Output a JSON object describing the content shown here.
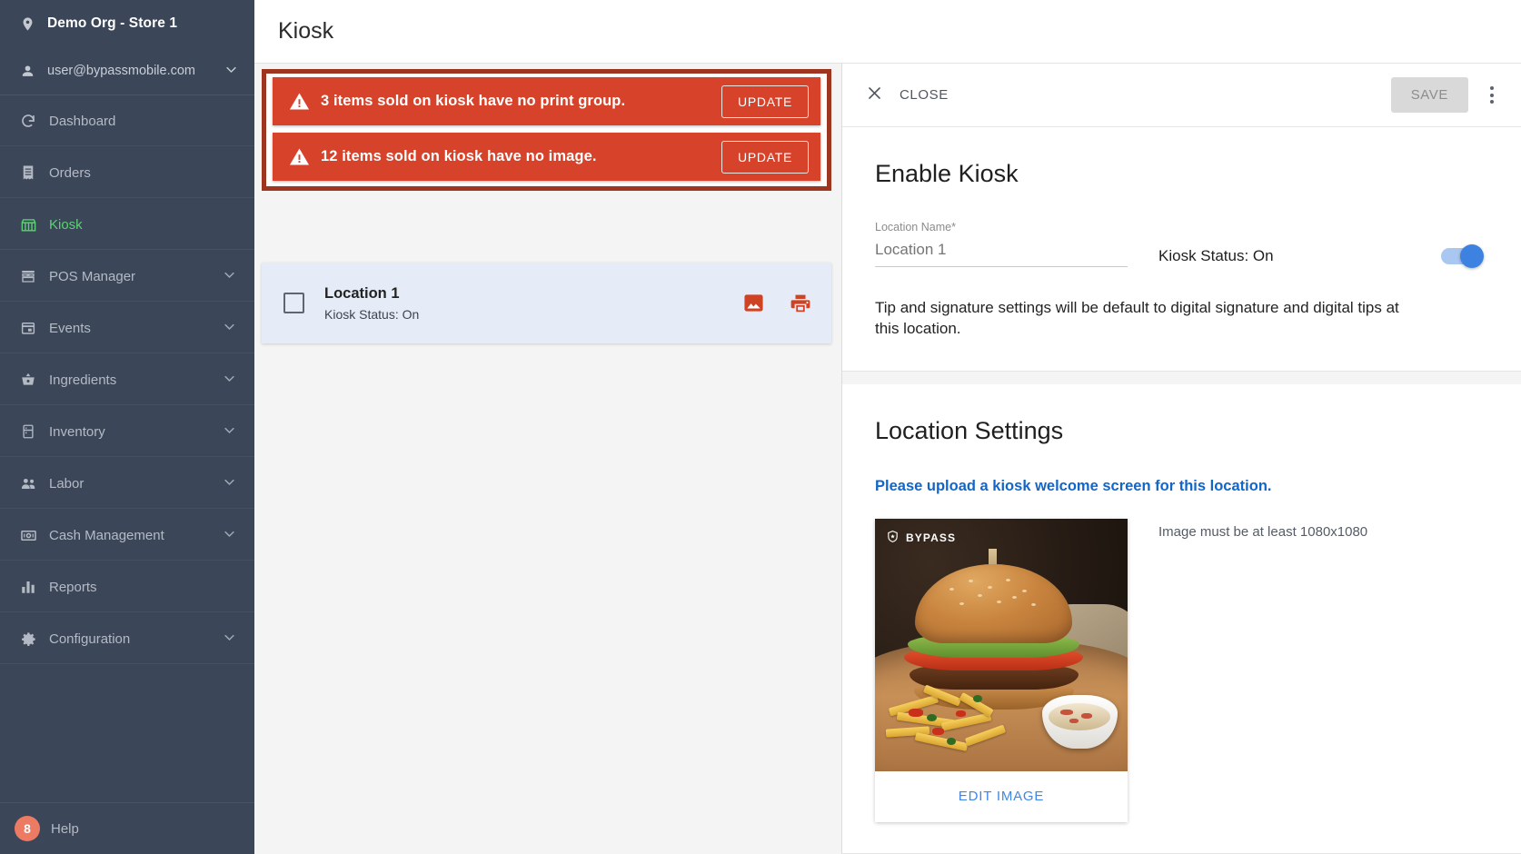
{
  "sidebar": {
    "org": {
      "label": "Demo Org - Store 1",
      "icon": "location-pin-icon"
    },
    "user": {
      "label": "user@bypassmobile.com",
      "icon": "person-icon",
      "chevron": "chevron-down-icon"
    },
    "items": [
      {
        "label": "Dashboard",
        "icon": "dashboard-icon",
        "expandable": false,
        "active": false
      },
      {
        "label": "Orders",
        "icon": "orders-receipt-icon",
        "expandable": false,
        "active": false
      },
      {
        "label": "Kiosk",
        "icon": "kiosk-store-icon",
        "expandable": false,
        "active": true
      },
      {
        "label": "POS Manager",
        "icon": "pos-store-icon",
        "expandable": true,
        "active": false
      },
      {
        "label": "Events",
        "icon": "calendar-icon",
        "expandable": true,
        "active": false
      },
      {
        "label": "Ingredients",
        "icon": "basket-icon",
        "expandable": true,
        "active": false
      },
      {
        "label": "Inventory",
        "icon": "fridge-icon",
        "expandable": true,
        "active": false
      },
      {
        "label": "Labor",
        "icon": "people-icon",
        "expandable": true,
        "active": false
      },
      {
        "label": "Cash Management",
        "icon": "cash-bill-icon",
        "expandable": true,
        "active": false
      },
      {
        "label": "Reports",
        "icon": "bar-chart-icon",
        "expandable": false,
        "active": false
      },
      {
        "label": "Configuration",
        "icon": "gear-icon",
        "expandable": true,
        "active": false
      }
    ],
    "help": {
      "label": "Help",
      "badge": "8"
    }
  },
  "header": {
    "title": "Kiosk"
  },
  "alerts": {
    "highlight_color": "#9e3520",
    "banner_color": "#d6432a",
    "items": [
      {
        "icon": "warning-triangle-icon",
        "message": "3 items sold on kiosk have no print group.",
        "action": "UPDATE"
      },
      {
        "icon": "warning-triangle-icon",
        "message": "12 items sold on kiosk have no image.",
        "action": "UPDATE"
      }
    ]
  },
  "location_list": {
    "rows": [
      {
        "name": "Location 1",
        "status": "Kiosk Status: On",
        "checkbox_checked": false,
        "icons": [
          {
            "name": "image-icon",
            "color": "#cf4224"
          },
          {
            "name": "printer-icon",
            "color": "#cf4224"
          }
        ]
      }
    ]
  },
  "drawer": {
    "close_label": "CLOSE",
    "close_icon": "close-x-icon",
    "save_label": "SAVE",
    "menu_icon": "kebab-menu-icon",
    "enable_kiosk": {
      "title": "Enable Kiosk",
      "field_label": "Location Name*",
      "field_value": "Location 1",
      "field_placeholder": "Location 1",
      "toggle_label": "Kiosk Status: On",
      "toggle_on": true,
      "toggle_color": "#3d82e0",
      "note": "Tip and signature settings will be default to digital signature and digital tips at this location."
    },
    "location_settings": {
      "title": "Location Settings",
      "upload_prompt": "Please upload a kiosk welcome screen for this location.",
      "upload_prompt_color": "#1266c9",
      "image_watermark": "BYPASS",
      "image_watermark_icon": "shield-star-icon",
      "edit_image_label": "EDIT IMAGE",
      "edit_image_color": "#3f86e8",
      "image_hint": "Image must be at least 1080x1080"
    }
  }
}
